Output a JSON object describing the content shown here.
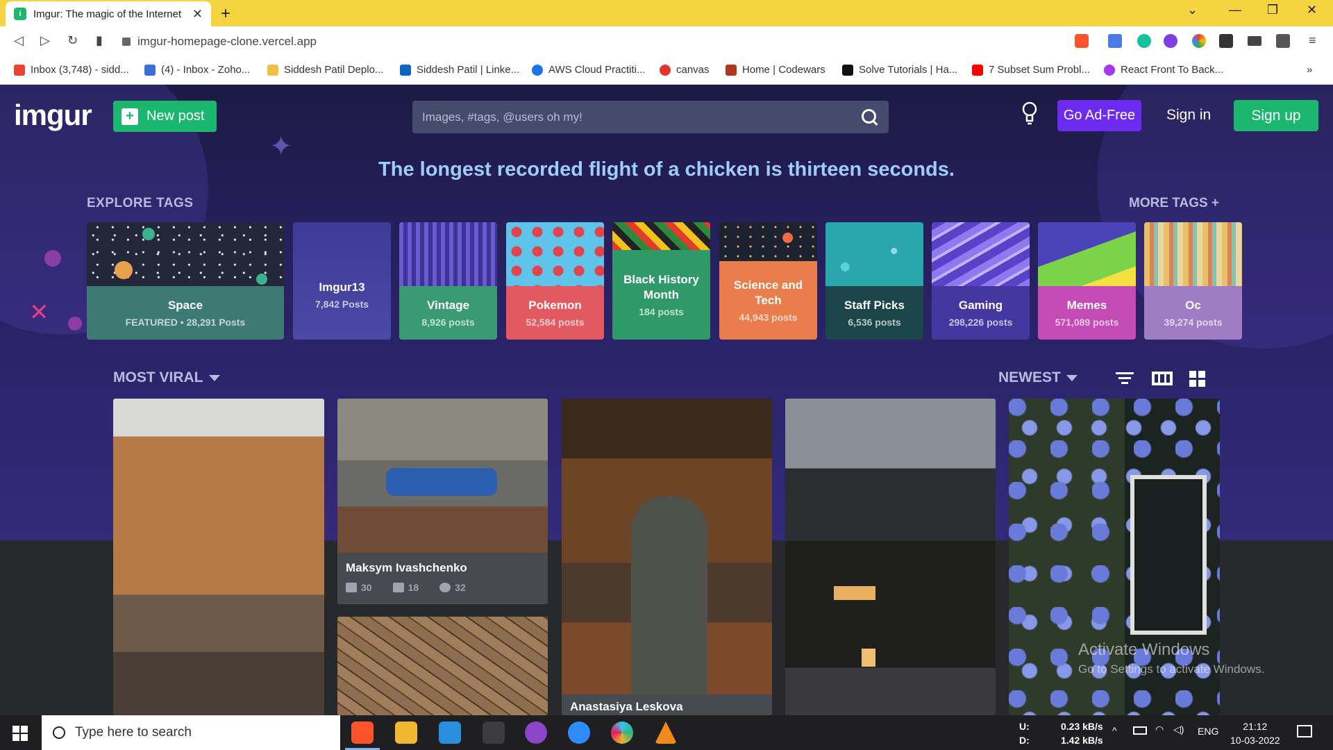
{
  "browser": {
    "tab_title": "Imgur: The magic of the Internet",
    "url": "imgur-homepage-clone.vercel.app",
    "bookmarks": [
      {
        "label": "Inbox (3,748) - sidd...",
        "color": "#ea4335"
      },
      {
        "label": "(4) - Inbox - Zoho...",
        "color": "#3a6fd8"
      },
      {
        "label": "Siddesh Patil Deplo...",
        "color": "#f0c040"
      },
      {
        "label": "Siddesh Patil | Linke...",
        "color": "#0a66c2"
      },
      {
        "label": "AWS Cloud Practiti...",
        "color": "#1a73e8"
      },
      {
        "label": "canvas",
        "color": "#e4332c"
      },
      {
        "label": "Home | Codewars",
        "color": "#b1361e"
      },
      {
        "label": "Solve Tutorials | Ha...",
        "color": "#111111"
      },
      {
        "label": "7 Subset Sum Probl...",
        "color": "#ff0000"
      },
      {
        "label": "React Front To Back...",
        "color": "#a435f0"
      }
    ]
  },
  "header": {
    "logo": "imgur",
    "new_post": "New post",
    "search_placeholder": "Images, #tags, @users oh my!",
    "go_ad_free": "Go Ad-Free",
    "sign_in": "Sign in",
    "sign_up": "Sign up"
  },
  "fact": "The longest recorded flight of a chicken is thirteen seconds.",
  "explore": {
    "heading": "EXPLORE TAGS",
    "more": "MORE TAGS +",
    "tags": [
      {
        "name": "Space",
        "count": "FEATURED • 28,291 Posts",
        "color": "#3d7a74"
      },
      {
        "name": "Imgur13",
        "count": "7,842 Posts",
        "color": "#4a4aa6"
      },
      {
        "name": "Vintage",
        "count": "8,926 posts",
        "color": "#3a9a73"
      },
      {
        "name": "Pokemon",
        "count": "52,584 posts",
        "color": "#e25a60"
      },
      {
        "name": "Black History Month",
        "count": "184 posts",
        "color": "#2f9a68"
      },
      {
        "name": "Science and Tech",
        "count": "44,943 posts",
        "color": "#ea7d4c"
      },
      {
        "name": "Staff Picks",
        "count": "6,536 posts",
        "color": "#1c4549"
      },
      {
        "name": "Gaming",
        "count": "298,226 posts",
        "color": "#4536a0"
      },
      {
        "name": "Memes",
        "count": "571,089 posts",
        "color": "#c44bb6"
      },
      {
        "name": "Oc",
        "count": "39,274 posts",
        "color": "#a07cc4"
      }
    ]
  },
  "gallery": {
    "sort": "MOST VIRAL",
    "order": "NEWEST",
    "posts": [
      {
        "author": "Maksym Ivashchenko",
        "upvotes": "30",
        "comments": "18",
        "views": "32"
      },
      {
        "author": "Anastasiya Leskova"
      }
    ]
  },
  "watermark": {
    "line1": "Activate Windows",
    "line2": "Go to Settings to activate Windows."
  },
  "taskbar": {
    "search_placeholder": "Type here to search",
    "net_up_label": "U:",
    "net_down_label": "D:",
    "net_up": "0.23 kB/s",
    "net_down": "1.42 kB/s",
    "lang": "ENG",
    "time": "21:12",
    "date": "10-03-2022"
  }
}
